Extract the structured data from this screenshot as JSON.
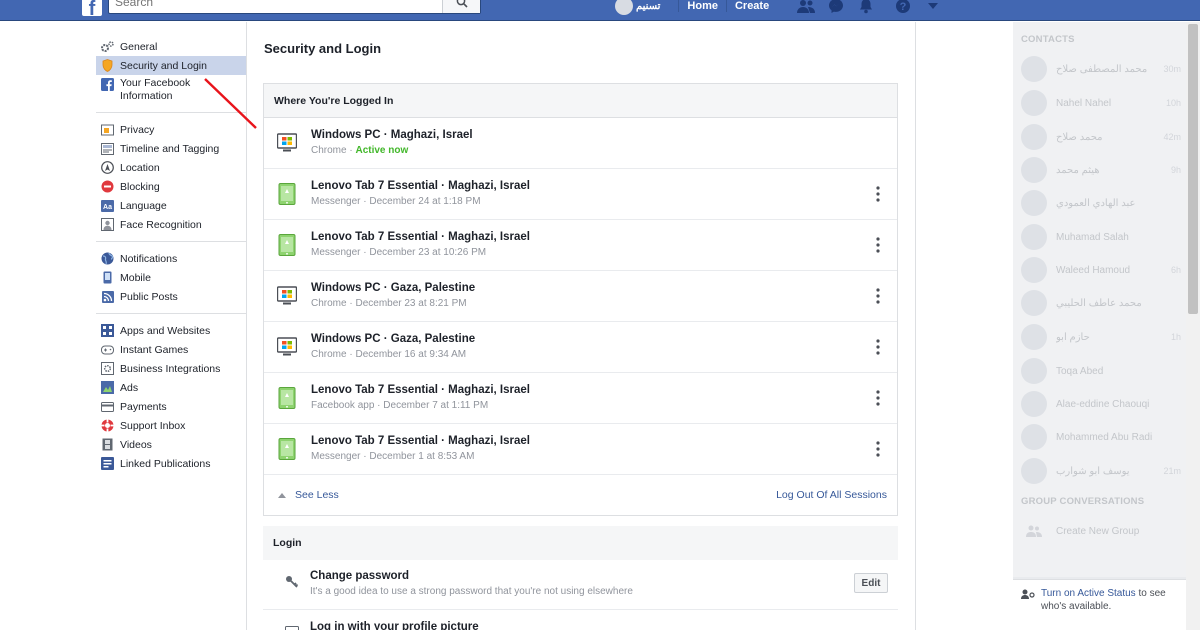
{
  "topbar": {
    "logo": "f",
    "search_placeholder": "Search",
    "user_name": "تسنيم",
    "home_label": "Home",
    "create_label": "Create",
    "icons": [
      "friends-icon",
      "messenger-icon",
      "bell-icon",
      "help-icon",
      "caret-down-icon"
    ]
  },
  "leftnav": {
    "group1": [
      {
        "label": "General",
        "icon": "gear-icon"
      },
      {
        "label": "Security and Login",
        "icon": "shield-icon",
        "selected": true
      },
      {
        "label": "Your Facebook Information",
        "icon": "facebook-icon"
      }
    ],
    "group2": [
      {
        "label": "Privacy",
        "icon": "lock-icon"
      },
      {
        "label": "Timeline and Tagging",
        "icon": "timeline-icon"
      },
      {
        "label": "Location",
        "icon": "location-icon"
      },
      {
        "label": "Blocking",
        "icon": "block-icon"
      },
      {
        "label": "Language",
        "icon": "language-icon"
      },
      {
        "label": "Face Recognition",
        "icon": "face-icon"
      }
    ],
    "group3": [
      {
        "label": "Notifications",
        "icon": "globe-icon"
      },
      {
        "label": "Mobile",
        "icon": "mobile-icon"
      },
      {
        "label": "Public Posts",
        "icon": "rss-icon"
      }
    ],
    "group4": [
      {
        "label": "Apps and Websites",
        "icon": "apps-icon"
      },
      {
        "label": "Instant Games",
        "icon": "gamepad-icon"
      },
      {
        "label": "Business Integrations",
        "icon": "business-icon"
      },
      {
        "label": "Ads",
        "icon": "ads-icon"
      },
      {
        "label": "Payments",
        "icon": "card-icon"
      },
      {
        "label": "Support Inbox",
        "icon": "lifebuoy-icon"
      },
      {
        "label": "Videos",
        "icon": "film-icon"
      },
      {
        "label": "Linked Publications",
        "icon": "publication-icon"
      }
    ]
  },
  "main": {
    "title": "Security and Login",
    "logged_in": {
      "header": "Where You're Logged In",
      "sessions": [
        {
          "device": "Windows PC · Maghazi, Israel",
          "app": "Chrome",
          "sep": " · ",
          "when": "Active now",
          "active": true,
          "type": "pc"
        },
        {
          "device": "Lenovo Tab 7 Essential · Maghazi, Israel",
          "app": "Messenger",
          "sep": " · ",
          "when": "December 24 at 1:18 PM",
          "active": false,
          "type": "tablet"
        },
        {
          "device": "Lenovo Tab 7 Essential · Maghazi, Israel",
          "app": "Messenger",
          "sep": " · ",
          "when": "December 23 at 10:26 PM",
          "active": false,
          "type": "tablet"
        },
        {
          "device": "Windows PC · Gaza, Palestine",
          "app": "Chrome",
          "sep": " · ",
          "when": "December 23 at 8:21 PM",
          "active": false,
          "type": "pc"
        },
        {
          "device": "Windows PC · Gaza, Palestine",
          "app": "Chrome",
          "sep": " · ",
          "when": "December 16 at 9:34 AM",
          "active": false,
          "type": "pc"
        },
        {
          "device": "Lenovo Tab 7 Essential · Maghazi, Israel",
          "app": "Facebook app",
          "sep": " · ",
          "when": "December 7 at 1:11 PM",
          "active": false,
          "type": "tablet"
        },
        {
          "device": "Lenovo Tab 7 Essential · Maghazi, Israel",
          "app": "Messenger",
          "sep": " · ",
          "when": "December 1 at 8:53 AM",
          "active": false,
          "type": "tablet"
        }
      ],
      "see_less": "See Less",
      "log_out_all": "Log Out Of All Sessions"
    },
    "login": {
      "header": "Login",
      "change_password": {
        "title": "Change password",
        "desc": "It's a good idea to use a strong password that you're not using elsewhere",
        "button": "Edit"
      },
      "profile_picture": {
        "title": "Log in with your profile picture"
      }
    }
  },
  "chat": {
    "contacts_header": "CONTACTS",
    "contacts": [
      {
        "name": "محمد المصطفى صلاح",
        "time": "30m"
      },
      {
        "name": "Nahel Nahel",
        "time": "10h"
      },
      {
        "name": "محمد صلاح",
        "time": "42m"
      },
      {
        "name": "هيثم محمد",
        "time": "9h"
      },
      {
        "name": "عبد الهادي العمودي",
        "time": ""
      },
      {
        "name": "Muhamad Salah",
        "time": ""
      },
      {
        "name": "Waleed Hamoud",
        "time": "6h"
      },
      {
        "name": "محمد عاطف الحليبي",
        "time": ""
      },
      {
        "name": "حازم ابو",
        "time": "1h"
      },
      {
        "name": "Toqa Abed",
        "time": ""
      },
      {
        "name": "Alae-eddine Chaouqi",
        "time": ""
      },
      {
        "name": "Mohammed Abu Radi",
        "time": ""
      },
      {
        "name": "يوسف ابو شوارب",
        "time": "21m"
      }
    ],
    "group_header": "GROUP CONVERSATIONS",
    "create_group": "Create New Group",
    "status_link": "Turn on Active Status",
    "status_rest": " to see who's available."
  }
}
